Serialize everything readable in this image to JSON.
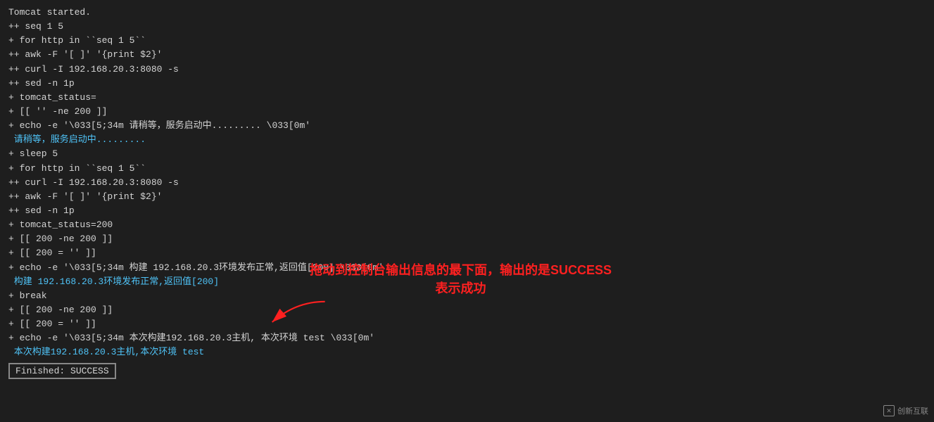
{
  "terminal": {
    "lines": [
      {
        "text": "Tomcat started.",
        "class": "normal"
      },
      {
        "text": "++ seq 1 5",
        "class": "normal"
      },
      {
        "text": "+ for http in ``seq 1 5``",
        "class": "normal"
      },
      {
        "text": "++ awk -F '[ ]' '{print $2}'",
        "class": "normal"
      },
      {
        "text": "++ curl -I 192.168.20.3:8080 -s",
        "class": "normal"
      },
      {
        "text": "++ sed -n 1p",
        "class": "normal"
      },
      {
        "text": "+ tomcat_status=",
        "class": "normal"
      },
      {
        "text": "+ [[ '' -ne 200 ]]",
        "class": "normal"
      },
      {
        "text": "+ echo -e '\\033[5;34m 请稍等，服务启动中......... \\033[0m'",
        "class": "normal"
      },
      {
        "text": " 请稍等，服务启动中.........",
        "class": "cyan"
      },
      {
        "text": "+ sleep 5",
        "class": "normal"
      },
      {
        "text": "+ for http in ``seq 1 5``",
        "class": "normal"
      },
      {
        "text": "++ curl -I 192.168.20.3:8080 -s",
        "class": "normal"
      },
      {
        "text": "++ awk -F '[ ]' '{print $2}'",
        "class": "normal"
      },
      {
        "text": "++ sed -n 1p",
        "class": "normal"
      },
      {
        "text": "+ tomcat_status=200",
        "class": "normal"
      },
      {
        "text": "+ [[ 200 -ne 200 ]]",
        "class": "normal"
      },
      {
        "text": "+ [[ 200 = '' ]]",
        "class": "normal"
      },
      {
        "text": "+ echo -e '\\033[5;34m 构建 192.168.20.3环境发布正常,返回值[200] \\033[0m'",
        "class": "normal"
      },
      {
        "text": " 构建 192.168.20.3环境发布正常,返回值[200]",
        "class": "cyan"
      },
      {
        "text": "+ break",
        "class": "normal"
      },
      {
        "text": "+ [[ 200 -ne 200 ]]",
        "class": "normal"
      },
      {
        "text": "+ [[ 200 = '' ]]",
        "class": "normal"
      },
      {
        "text": "+ echo -e '\\033[5;34m 本次构建192.168.20.3主机, 本次环境 test \\033[0m'",
        "class": "normal"
      },
      {
        "text": " 本次构建192.168.20.3主机,本次环境 test",
        "class": "cyan"
      },
      {
        "text": "Finished: SUCCESS",
        "class": "finished"
      }
    ]
  },
  "annotation": {
    "line1": "拖动到控制台输出信息的最下面，输出的是SUCCESS",
    "line2": "表示成功"
  },
  "watermark": {
    "text": "创新互联",
    "symbol": "✕"
  }
}
